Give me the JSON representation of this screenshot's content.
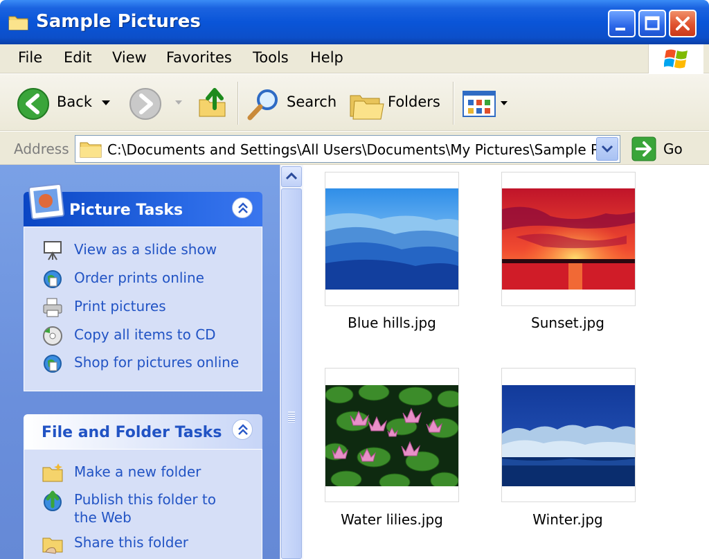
{
  "window": {
    "title": "Sample Pictures"
  },
  "menu": {
    "items": [
      "File",
      "Edit",
      "View",
      "Favorites",
      "Tools",
      "Help"
    ]
  },
  "toolbar": {
    "back_label": "Back",
    "search_label": "Search",
    "folders_label": "Folders"
  },
  "address": {
    "label": "Address",
    "value": "C:\\Documents and Settings\\All Users\\Documents\\My Pictures\\Sample Pic",
    "go_label": "Go"
  },
  "picture_tasks": {
    "title": "Picture Tasks",
    "items": [
      {
        "label": "View as a slide show",
        "icon": "slideshow-icon"
      },
      {
        "label": "Order prints online",
        "icon": "globe-icon"
      },
      {
        "label": "Print pictures",
        "icon": "printer-icon"
      },
      {
        "label": "Copy all items to CD",
        "icon": "cd-icon"
      },
      {
        "label": "Shop for pictures online",
        "icon": "globe-icon"
      }
    ]
  },
  "file_tasks": {
    "title": "File and Folder Tasks",
    "items": [
      {
        "label": "Make a new folder",
        "icon": "new-folder-icon"
      },
      {
        "label": "Publish this folder to",
        "label2": "the Web",
        "icon": "publish-icon"
      },
      {
        "label": "Share this folder",
        "icon": "share-folder-icon"
      }
    ]
  },
  "files": [
    {
      "name": "Blue hills.jpg"
    },
    {
      "name": "Sunset.jpg"
    },
    {
      "name": "Water lilies.jpg"
    },
    {
      "name": "Winter.jpg"
    }
  ],
  "colors": {
    "titlebar": "#0a55d8",
    "taskpane": "#6a8fdc",
    "task_link": "#2153c4"
  }
}
